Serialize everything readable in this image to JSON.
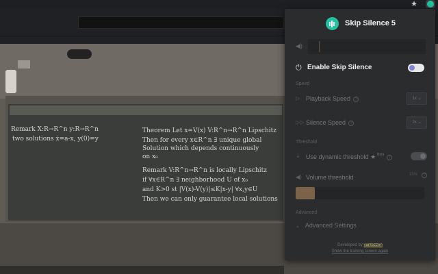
{
  "browser": {
    "star_icon": "star-icon",
    "extension_icon": "skip-silence-extension-icon"
  },
  "page": {
    "chalkboard_lines": [
      "Remark  X:R→R^n  y:R→R^n",
      "two solutions  ẋ=a-x, y(0)=y",
      "Theorem  Let x=V(x)  V:R^n→R^n Lipschitz",
      "Then for every x∈R^n ∃ unique global",
      "Solution which depends continuously",
      "on x₀",
      "Remark  V:R^n→R^n is locally Lipschitz",
      "if ∀x∈R^n ∃ neighborhood U of x₀",
      "and K>0 st |V(x)-V(y)|≤K|x-y| ∀x,y∈U",
      "Then we can only guarantee local solutions"
    ]
  },
  "popup": {
    "title": "Skip Silence 5",
    "enable_label": "Enable Skip Silence",
    "enabled": false,
    "speed_section": "Speed",
    "playback_speed_label": "Playback Speed",
    "playback_speed_value": "1x",
    "silence_speed_label": "Silence Speed",
    "silence_speed_value": "2x",
    "threshold_section": "Threshold",
    "dynamic_threshold_label": "Use dynamic threshold",
    "dynamic_threshold_beta": "Beta",
    "volume_threshold_label": "Volume threshold",
    "volume_threshold_value": "15%",
    "volume_threshold_fraction": 0.15,
    "advanced_section": "Advanced",
    "advanced_settings_label": "Advanced Settings",
    "developed_by_prefix": "Developed by ",
    "developer_name": "vantezzen",
    "training_link": "Show the training screen again",
    "colors": {
      "accent": "#23c2a1",
      "toggle_knob": "#7f86d9",
      "developer_link": "#e3d27a",
      "threshold_fill": "#7a6348"
    }
  }
}
